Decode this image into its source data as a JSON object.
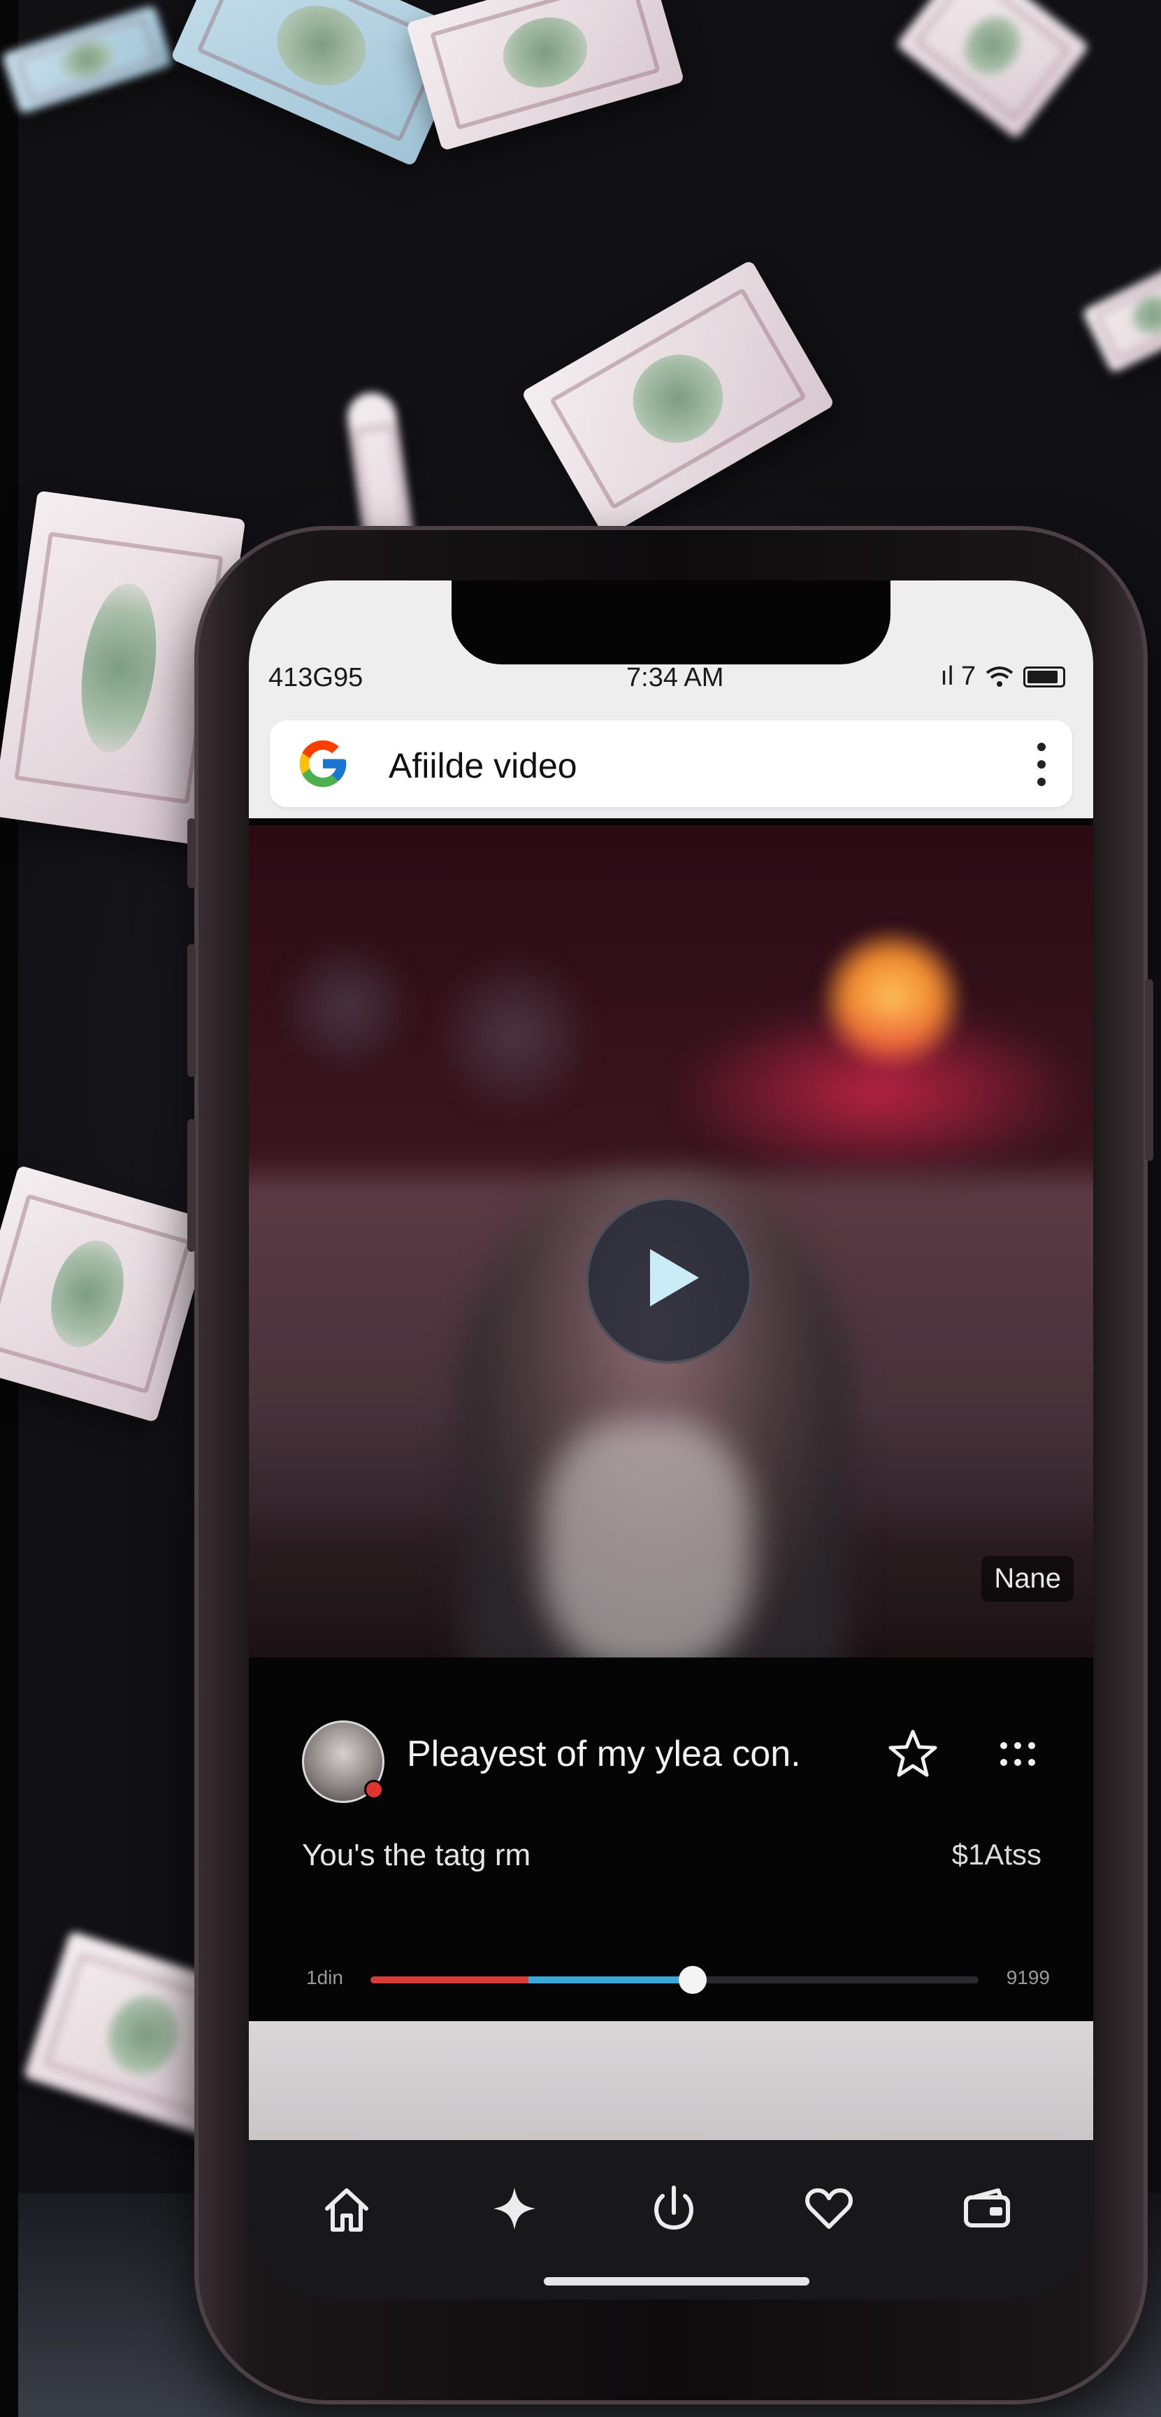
{
  "status_bar": {
    "left": "413G95",
    "time": "7:34 AM",
    "signal": "ıl 7"
  },
  "search_bar": {
    "query": "Afiilde video",
    "logo": "google-g-icon",
    "menu_icon": "kebab-menu-icon"
  },
  "video": {
    "badge": "Nane",
    "play_icon": "play-icon"
  },
  "info": {
    "title": "Pleayest of my ylea con.",
    "subtitle": "You's the tatg rm",
    "price": "$1Atss",
    "time_elapsed": "1din",
    "time_total": "9199",
    "progress": 0.53,
    "buffer_start": 0.26
  },
  "nav": {
    "items": [
      "home-icon",
      "sparkle-icon",
      "power-icon",
      "heart-icon",
      "wallet-icon"
    ]
  },
  "colors": {
    "progress_played": "#d73a3a",
    "progress_buffer": "#3aa8d8",
    "accent": "#e0342f"
  }
}
